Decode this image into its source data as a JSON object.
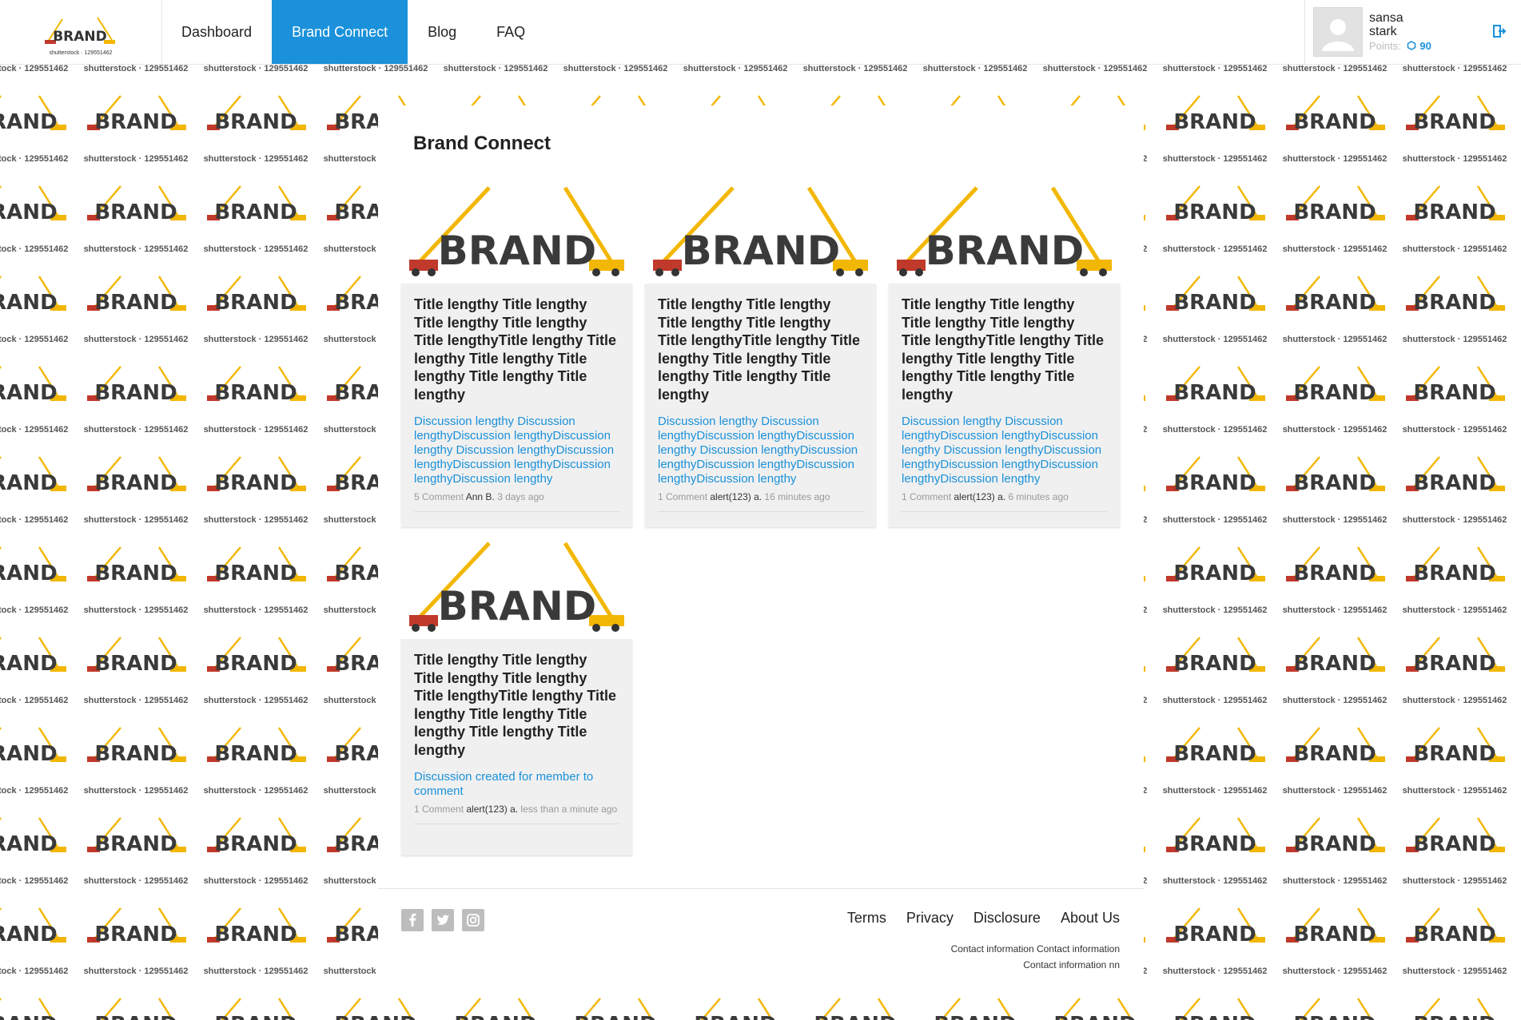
{
  "header": {
    "logo_text": "BRAND",
    "logo_caption": "shutterstock · 129551462",
    "nav": [
      {
        "label": "Dashboard",
        "active": false
      },
      {
        "label": "Brand Connect",
        "active": true
      },
      {
        "label": "Blog",
        "active": false
      },
      {
        "label": "FAQ",
        "active": false
      }
    ],
    "user": {
      "first_name": "sansa",
      "last_name": "stark",
      "points_label": "Points:",
      "points_value": "90"
    },
    "logout_icon": "logout-icon"
  },
  "background": {
    "watermark": "shutterstock · 129551462",
    "logo_text": "BRAND"
  },
  "main": {
    "title": "Brand Connect",
    "cards": [
      {
        "image_text": "BRAND",
        "title": "Title lengthy Title lengthy Title lengthy Title lengthy Title lengthyTitle lengthy Title lengthy Title lengthy Title lengthy Title lengthy Title lengthy",
        "discussion": "Discussion lengthy Discussion lengthyDiscussion lengthyDiscussion lengthy Discussion lengthyDiscussion lengthyDiscussion lengthyDiscussion lengthyDiscussion lengthy",
        "comments": "5 Comment",
        "author": "Ann B.",
        "time": "3 days ago"
      },
      {
        "image_text": "BRAND",
        "title": "Title lengthy Title lengthy Title lengthy Title lengthy Title lengthyTitle lengthy Title lengthy Title lengthy Title lengthy Title lengthy Title lengthy",
        "discussion": "Discussion lengthy Discussion lengthyDiscussion lengthyDiscussion lengthy Discussion lengthyDiscussion lengthyDiscussion lengthyDiscussion lengthyDiscussion lengthy",
        "comments": "1 Comment",
        "author": "alert(123) a.",
        "time": "16 minutes ago"
      },
      {
        "image_text": "BRAND",
        "title": "Title lengthy Title lengthy Title lengthy Title lengthy Title lengthyTitle lengthy Title lengthy Title lengthy Title lengthy Title lengthy Title lengthy",
        "discussion": "Discussion lengthy Discussion lengthyDiscussion lengthyDiscussion lengthy Discussion lengthyDiscussion lengthyDiscussion lengthyDiscussion lengthyDiscussion lengthy",
        "comments": "1 Comment",
        "author": "alert(123) a.",
        "time": "6 minutes ago"
      },
      {
        "image_text": "BRAND",
        "title": "Title lengthy Title lengthy Title lengthy Title lengthy Title lengthyTitle lengthy Title lengthy Title lengthy Title lengthy Title lengthy Title lengthy",
        "discussion": "Discussion created for member to comment",
        "comments": "1 Comment",
        "author": "alert(123) a.",
        "time": "less than a minute ago"
      }
    ]
  },
  "footer": {
    "social": [
      "facebook-icon",
      "twitter-icon",
      "instagram-icon"
    ],
    "links": [
      "Terms",
      "Privacy",
      "Disclosure",
      "About Us"
    ],
    "contact_line1": "Contact information Contact information",
    "contact_line2": "Contact information nn"
  },
  "colors": {
    "accent": "#1a91da",
    "card_bg": "#f0f0f0",
    "crane": "#f2b705"
  }
}
